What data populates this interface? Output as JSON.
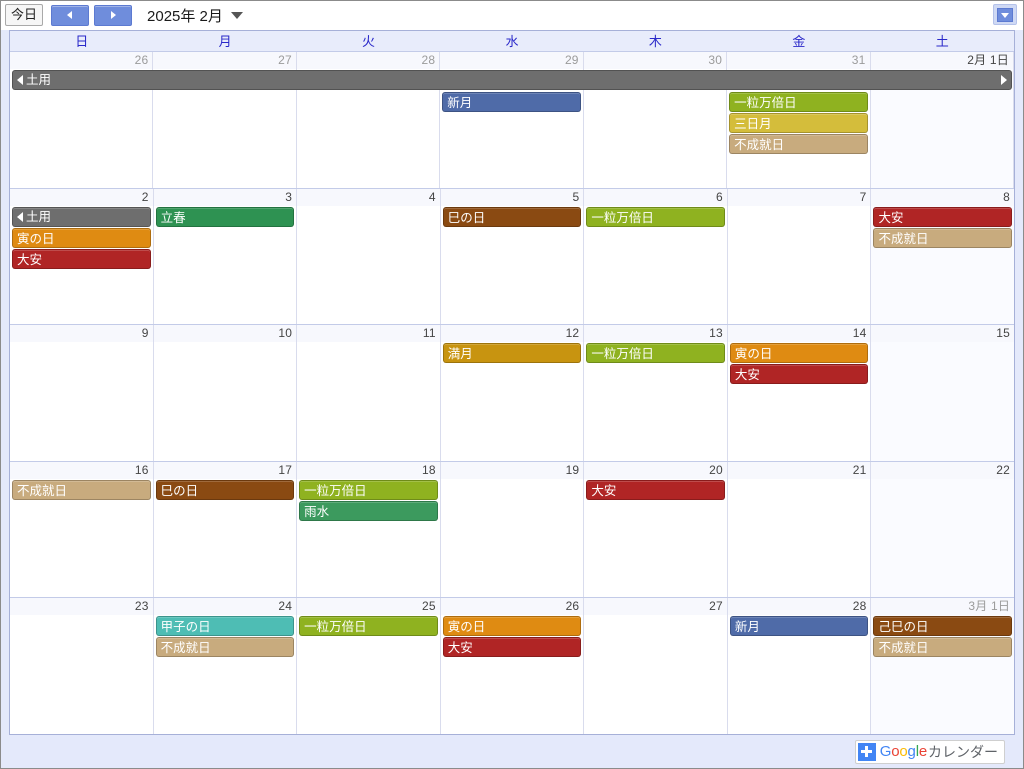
{
  "toolbar": {
    "today_label": "今日",
    "prev_icon": "left-arrow-icon",
    "next_icon": "right-arrow-icon",
    "title": "2025年 2月",
    "dropdown_icon": "caret-down-icon",
    "options_icon": "options-dropdown-icon"
  },
  "weekdays": [
    "日",
    "月",
    "火",
    "水",
    "木",
    "金",
    "土"
  ],
  "colors": {
    "ichiryu": "#8FB220",
    "mikazuki": "#D4BD3B",
    "fujoju": "#C8AB7E",
    "shingetsu": "#4F6BA8",
    "taian": "#B02525",
    "tora": "#DF8B12",
    "mi": "#8A4A12",
    "doyo": "#6E6E6E",
    "risshun": "#2E9252",
    "usui": "#3C9A5E",
    "mangetsu": "#C89410",
    "kinoene": "#4EBDB4"
  },
  "banner": {
    "label": "土用",
    "left_arrow": "◀",
    "right_arrow": "▶",
    "color_key": "doyo"
  },
  "weeks": [
    {
      "banner": true,
      "days": [
        {
          "num": "26",
          "other": true,
          "sat": false,
          "events": []
        },
        {
          "num": "27",
          "other": true,
          "sat": false,
          "events": []
        },
        {
          "num": "28",
          "other": true,
          "sat": false,
          "events": []
        },
        {
          "num": "29",
          "other": true,
          "sat": false,
          "events": [
            {
              "label": "新月",
              "color_key": "shingetsu"
            }
          ]
        },
        {
          "num": "30",
          "other": true,
          "sat": false,
          "events": []
        },
        {
          "num": "31",
          "other": true,
          "sat": false,
          "events": [
            {
              "label": "一粒万倍日",
              "color_key": "ichiryu"
            },
            {
              "label": "三日月",
              "color_key": "mikazuki"
            },
            {
              "label": "不成就日",
              "color_key": "fujoju"
            }
          ]
        },
        {
          "num": "2月 1日",
          "other": false,
          "sat": true,
          "events": []
        }
      ]
    },
    {
      "banner": false,
      "days": [
        {
          "num": "2",
          "other": false,
          "sat": false,
          "events": [
            {
              "label": "土用",
              "color_key": "doyo",
              "arrow": "left"
            },
            {
              "label": "寅の日",
              "color_key": "tora"
            },
            {
              "label": "大安",
              "color_key": "taian"
            }
          ]
        },
        {
          "num": "3",
          "other": false,
          "sat": false,
          "events": [
            {
              "label": "立春",
              "color_key": "risshun"
            }
          ]
        },
        {
          "num": "4",
          "other": false,
          "sat": false,
          "events": []
        },
        {
          "num": "5",
          "other": false,
          "sat": false,
          "events": [
            {
              "label": "巳の日",
              "color_key": "mi"
            }
          ]
        },
        {
          "num": "6",
          "other": false,
          "sat": false,
          "events": [
            {
              "label": "一粒万倍日",
              "color_key": "ichiryu"
            }
          ]
        },
        {
          "num": "7",
          "other": false,
          "sat": false,
          "events": []
        },
        {
          "num": "8",
          "other": false,
          "sat": true,
          "events": [
            {
              "label": "大安",
              "color_key": "taian"
            },
            {
              "label": "不成就日",
              "color_key": "fujoju"
            }
          ]
        }
      ]
    },
    {
      "banner": false,
      "days": [
        {
          "num": "9",
          "other": false,
          "sat": false,
          "events": []
        },
        {
          "num": "10",
          "other": false,
          "sat": false,
          "events": []
        },
        {
          "num": "11",
          "other": false,
          "sat": false,
          "events": []
        },
        {
          "num": "12",
          "other": false,
          "sat": false,
          "events": [
            {
              "label": "満月",
              "color_key": "mangetsu"
            }
          ]
        },
        {
          "num": "13",
          "other": false,
          "sat": false,
          "events": [
            {
              "label": "一粒万倍日",
              "color_key": "ichiryu"
            }
          ]
        },
        {
          "num": "14",
          "other": false,
          "sat": false,
          "events": [
            {
              "label": "寅の日",
              "color_key": "tora"
            },
            {
              "label": "大安",
              "color_key": "taian"
            }
          ]
        },
        {
          "num": "15",
          "other": false,
          "sat": true,
          "events": []
        }
      ]
    },
    {
      "banner": false,
      "days": [
        {
          "num": "16",
          "other": false,
          "sat": false,
          "events": [
            {
              "label": "不成就日",
              "color_key": "fujoju"
            }
          ]
        },
        {
          "num": "17",
          "other": false,
          "sat": false,
          "events": [
            {
              "label": "巳の日",
              "color_key": "mi"
            }
          ]
        },
        {
          "num": "18",
          "other": false,
          "sat": false,
          "events": [
            {
              "label": "一粒万倍日",
              "color_key": "ichiryu"
            },
            {
              "label": "雨水",
              "color_key": "usui"
            }
          ]
        },
        {
          "num": "19",
          "other": false,
          "sat": false,
          "events": []
        },
        {
          "num": "20",
          "other": false,
          "sat": false,
          "events": [
            {
              "label": "大安",
              "color_key": "taian"
            }
          ]
        },
        {
          "num": "21",
          "other": false,
          "sat": false,
          "events": []
        },
        {
          "num": "22",
          "other": false,
          "sat": true,
          "events": []
        }
      ]
    },
    {
      "banner": false,
      "days": [
        {
          "num": "23",
          "other": false,
          "sat": false,
          "events": []
        },
        {
          "num": "24",
          "other": false,
          "sat": false,
          "events": [
            {
              "label": "甲子の日",
              "color_key": "kinoene"
            },
            {
              "label": "不成就日",
              "color_key": "fujoju"
            }
          ]
        },
        {
          "num": "25",
          "other": false,
          "sat": false,
          "events": [
            {
              "label": "一粒万倍日",
              "color_key": "ichiryu"
            }
          ]
        },
        {
          "num": "26",
          "other": false,
          "sat": false,
          "events": [
            {
              "label": "寅の日",
              "color_key": "tora"
            },
            {
              "label": "大安",
              "color_key": "taian"
            }
          ]
        },
        {
          "num": "27",
          "other": false,
          "sat": false,
          "events": []
        },
        {
          "num": "28",
          "other": false,
          "sat": false,
          "events": [
            {
              "label": "新月",
              "color_key": "shingetsu"
            }
          ]
        },
        {
          "num": "3月 1日",
          "other": true,
          "sat": true,
          "events": [
            {
              "label": "己巳の日",
              "color_key": "mi"
            },
            {
              "label": "不成就日",
              "color_key": "fujoju"
            }
          ]
        }
      ]
    }
  ],
  "footer": {
    "plus_icon": "plus-icon",
    "google_letters": [
      "G",
      "o",
      "o",
      "g",
      "l",
      "e"
    ],
    "calendar_label": "カレンダー"
  }
}
